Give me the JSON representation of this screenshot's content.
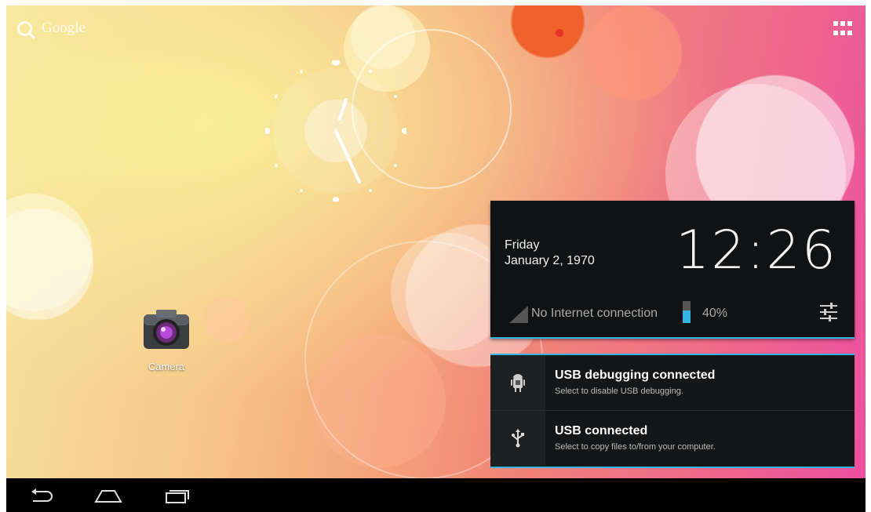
{
  "search": {
    "label": "Google",
    "icon": "search-icon"
  },
  "apps_button": {
    "icon": "all-apps-icon"
  },
  "desktop": {
    "shortcuts": [
      {
        "label": "Camera",
        "icon": "camera-icon"
      }
    ]
  },
  "notification_panel": {
    "day": "Friday",
    "date": "January 2, 1970",
    "time": "12:26",
    "network_status": "No Internet connection",
    "battery_percent": "40%",
    "battery_level": 0.4,
    "accent_color": "#33b5e5"
  },
  "notifications": [
    {
      "title": "USB debugging connected",
      "subtitle": "Select to disable USB debugging.",
      "icon": "android-debug-icon"
    },
    {
      "title": "USB connected",
      "subtitle": "Select to copy files to/from your computer.",
      "icon": "usb-icon"
    }
  ],
  "navigation": {
    "buttons": [
      {
        "icon": "back-icon"
      },
      {
        "icon": "home-icon"
      },
      {
        "icon": "recent-apps-icon"
      }
    ]
  }
}
